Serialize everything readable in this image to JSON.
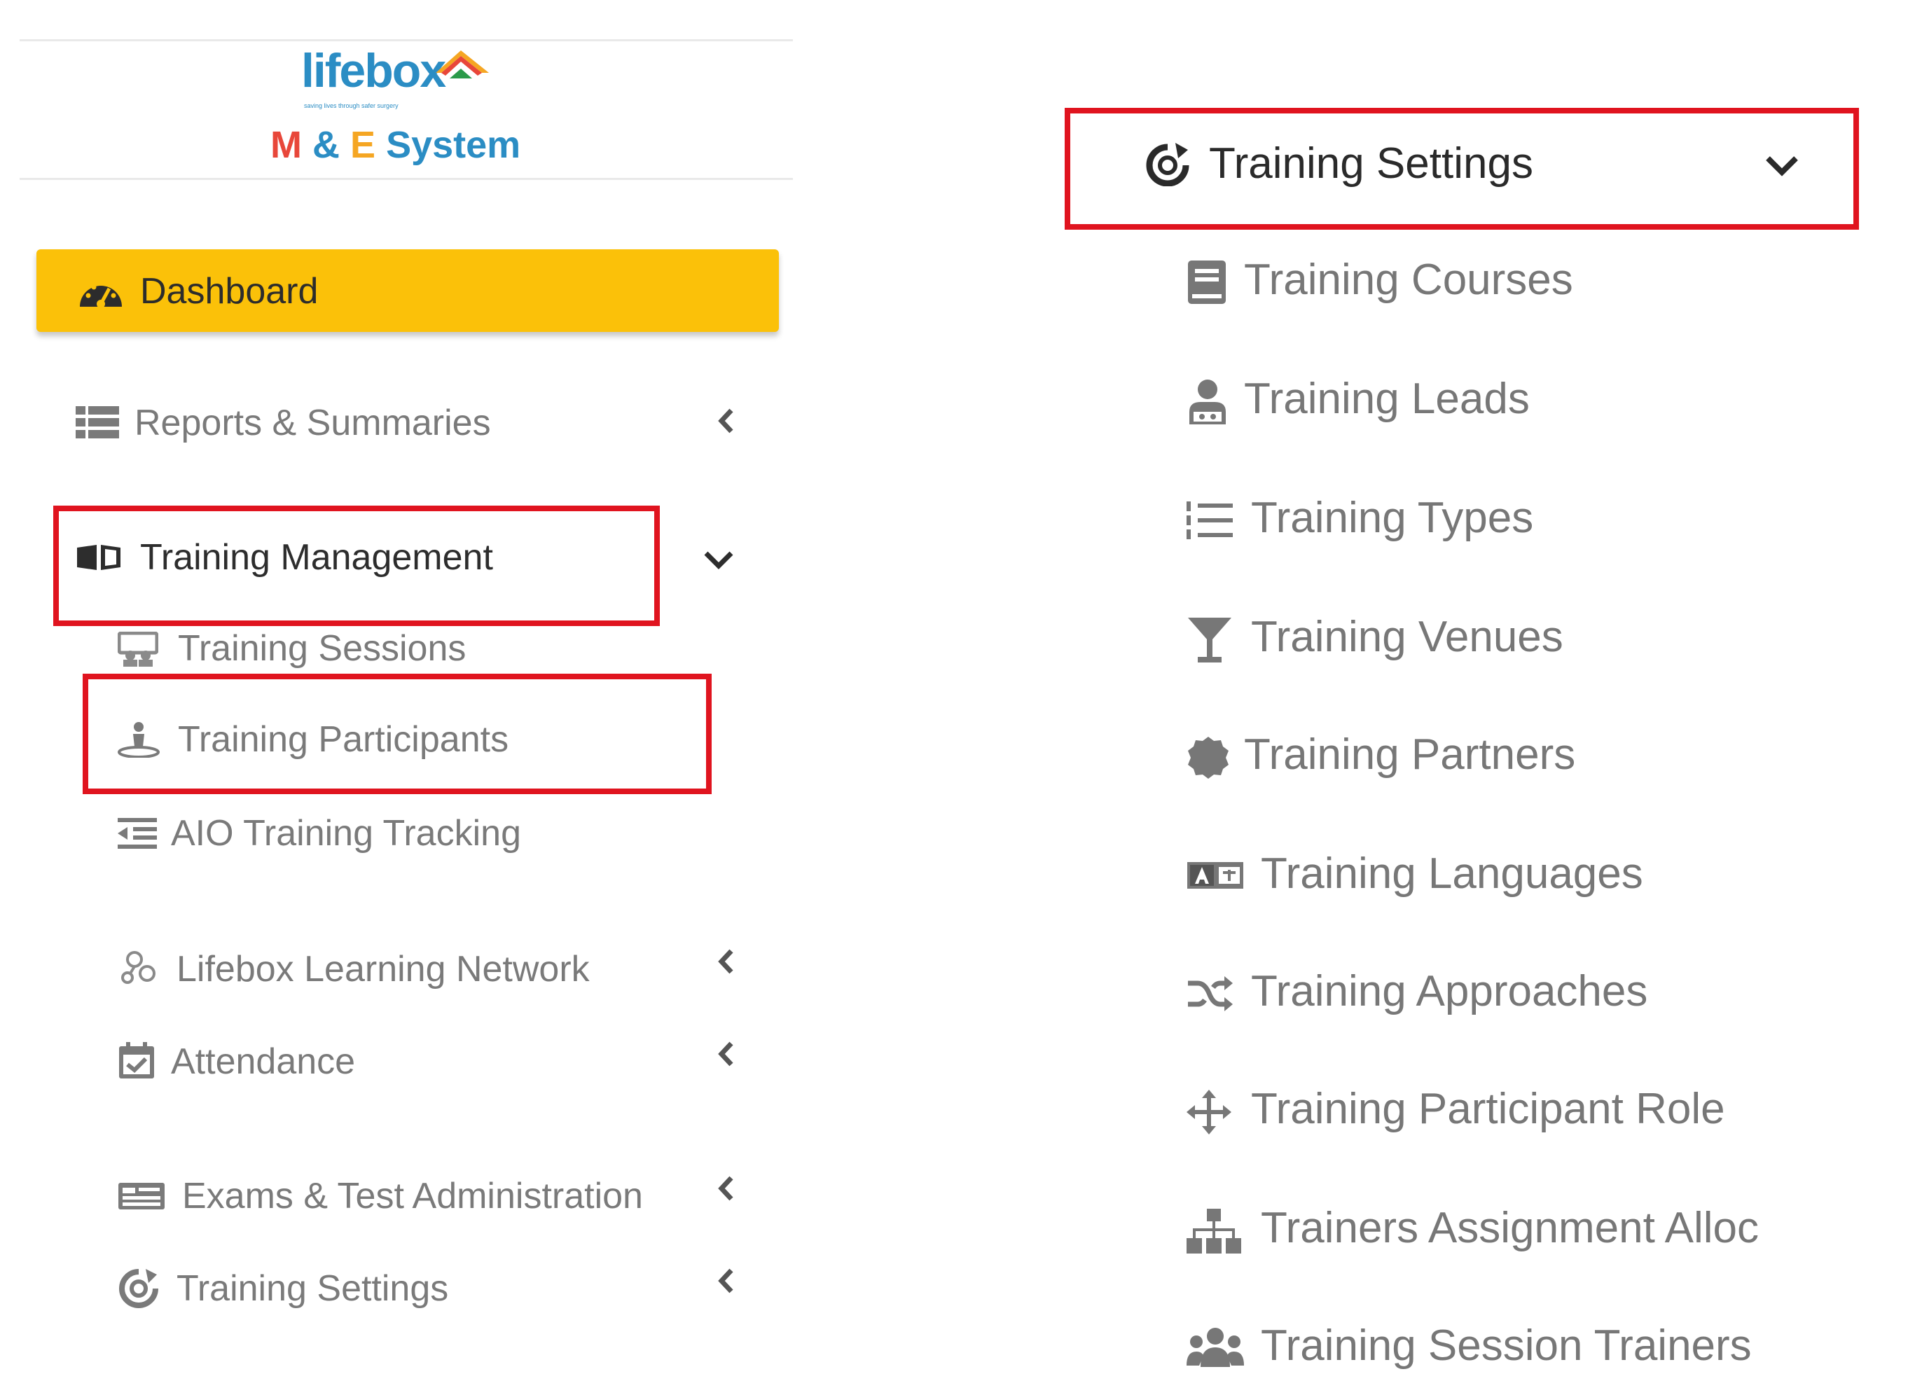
{
  "brand": {
    "logo_text": "lifebox",
    "tagline": "saving lives through safer surgery",
    "system_m": "M",
    "system_amp": "&",
    "system_e": "E",
    "system_word": "System"
  },
  "sidebar": {
    "dashboard": {
      "label": "Dashboard",
      "icon": "tachometer-icon",
      "color": "#fbc109"
    },
    "reports": {
      "label": "Reports & Summaries",
      "icon": "list-icon"
    },
    "training_management": {
      "label": "Training Management",
      "icon": "book-open-icon",
      "children": [
        {
          "label": "Training Sessions",
          "icon": "chalkboard-icon"
        },
        {
          "label": "Training Participants",
          "icon": "person-icon"
        },
        {
          "label": "AIO Training Tracking",
          "icon": "outdent-icon"
        }
      ]
    },
    "learning_network": {
      "label": "Lifebox Learning Network",
      "icon": "network-icon"
    },
    "attendance": {
      "label": "Attendance",
      "icon": "calendar-check-icon"
    },
    "exams": {
      "label": "Exams & Test Administration",
      "icon": "id-card-icon"
    },
    "training_settings": {
      "label": "Training Settings",
      "icon": "settings-ring-icon"
    }
  },
  "settings_menu": {
    "header": {
      "label": "Training Settings",
      "icon": "settings-ring-icon"
    },
    "items": [
      {
        "label": "Training Courses",
        "icon": "book-icon"
      },
      {
        "label": "Training Leads",
        "icon": "user-tie-icon"
      },
      {
        "label": "Training Types",
        "icon": "list-ol-icon"
      },
      {
        "label": "Training Venues",
        "icon": "glass-icon"
      },
      {
        "label": "Training Partners",
        "icon": "badge-icon"
      },
      {
        "label": "Training Languages",
        "icon": "language-icon"
      },
      {
        "label": "Training Approaches",
        "icon": "random-icon"
      },
      {
        "label": "Training Participant Role",
        "icon": "arrows-icon"
      },
      {
        "label": "Trainers Assignment Alloc",
        "icon": "sitemap-icon"
      },
      {
        "label": "Training Session Trainers",
        "icon": "users-icon"
      }
    ]
  },
  "highlight_color": "#e0141f"
}
